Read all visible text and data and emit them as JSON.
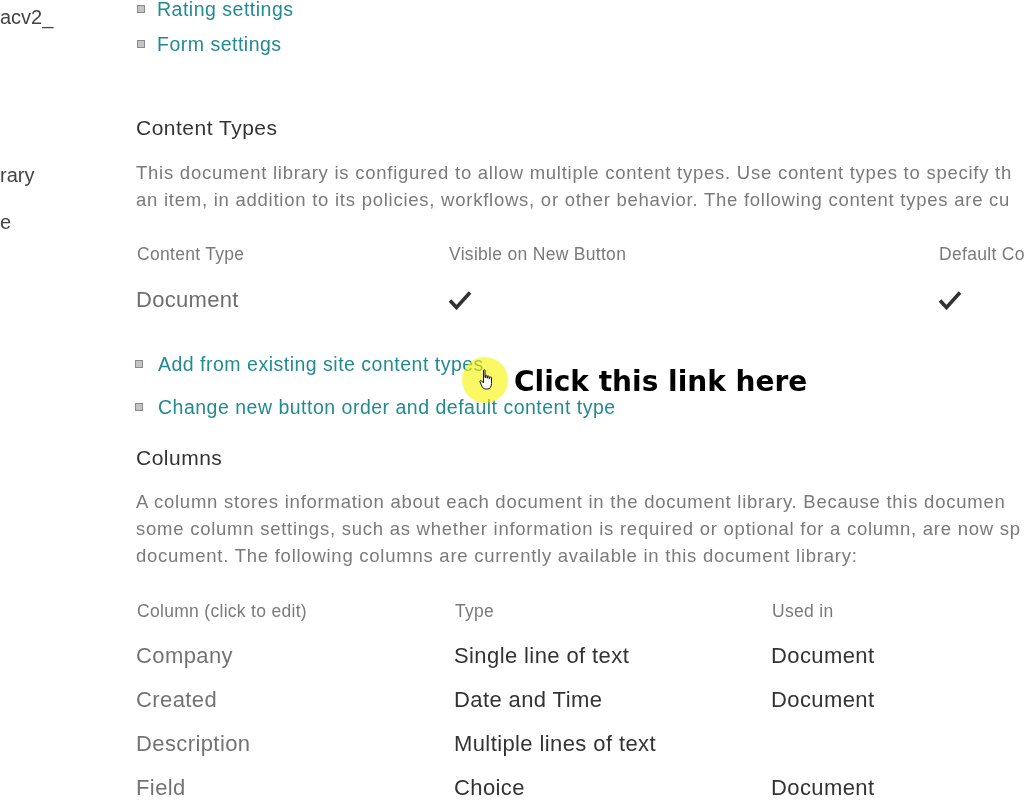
{
  "sidebar": {
    "items": [
      "acv2_",
      "rary",
      "e"
    ]
  },
  "settings_links": [
    "Rating settings",
    "Form settings"
  ],
  "content_types": {
    "heading": "Content Types",
    "description_lines": [
      "This document library is configured to allow multiple content types. Use content types to specify th",
      "an item, in addition to its policies, workflows, or other behavior. The following content types are cu"
    ],
    "table": {
      "columns": [
        "Content Type",
        "Visible on New Button",
        "Default Co"
      ],
      "rows": [
        {
          "content_type": "Document",
          "visible_on_new_button": true,
          "column_3": true
        }
      ]
    },
    "links": [
      "Add from existing site content types",
      "Change new button order and default content type"
    ]
  },
  "annotation": {
    "text": "Click this link here"
  },
  "columns": {
    "heading": "Columns",
    "description_lines": [
      "A column stores information about each document in the document library. Because this documen",
      "some column settings, such as whether information is required or optional for a column, are now sp",
      "document. The following columns are currently available in this document library:"
    ],
    "table": {
      "columns": [
        "Column (click to edit)",
        "Type",
        "Used in"
      ],
      "rows": [
        {
          "column": "Company",
          "type": "Single line of text",
          "used_in": "Document"
        },
        {
          "column": "Created",
          "type": "Date and Time",
          "used_in": "Document"
        },
        {
          "column": "Description",
          "type": "Multiple lines of text"
        },
        {
          "column": "Field",
          "type": "Choice",
          "used_in": "Document"
        }
      ]
    }
  }
}
